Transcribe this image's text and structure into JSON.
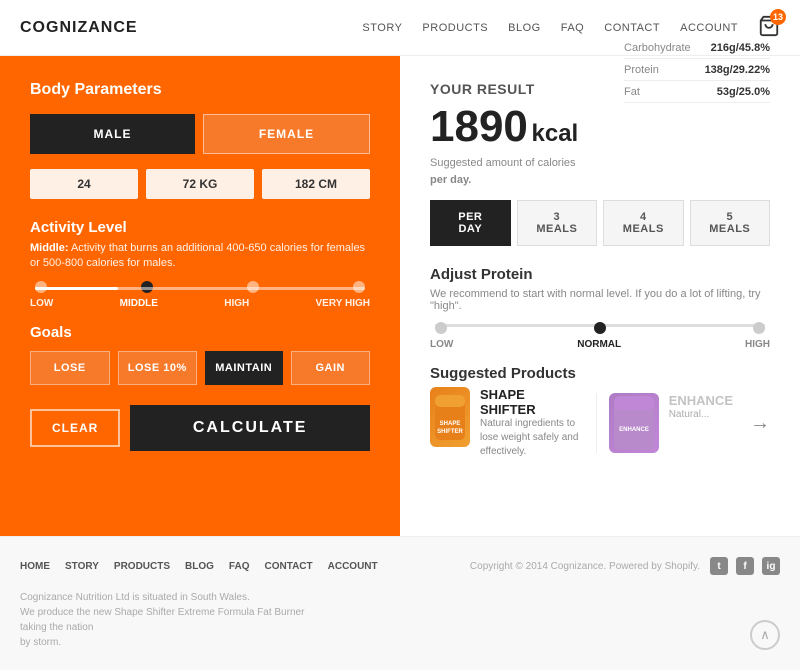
{
  "header": {
    "logo": "COGNIZANCE",
    "nav_items": [
      "STORY",
      "PRODUCTS",
      "BLOG",
      "FAQ",
      "CONTACT",
      "ACCOUNT"
    ],
    "cart_count": "13"
  },
  "left_panel": {
    "body_params_title": "Body Parameters",
    "gender_male": "MALE",
    "gender_female": "FEMALE",
    "age_value": "24",
    "weight_value": "72 KG",
    "height_value": "182 CM",
    "activity_title": "Activity Level",
    "activity_desc_bold": "Middle:",
    "activity_desc": " Activity that burns an additional 400-650 calories for females or 500-800 calories for males.",
    "activity_levels": [
      "LOW",
      "MIDDLE",
      "HIGH",
      "VERY HIGH"
    ],
    "active_level": "MIDDLE",
    "goals_title": "Goals",
    "goals": [
      "LOSE",
      "LOSE 10%",
      "MAINTAIN",
      "GAIN"
    ],
    "active_goal": "MAINTAIN",
    "clear_btn": "CLEAR",
    "calculate_btn": "CALcULATE"
  },
  "right_panel": {
    "result_title": "Your Result",
    "kcal_value": "1890",
    "kcal_unit": "kcal",
    "kcal_desc_line1": "Suggested amount of calories",
    "kcal_desc_line2": "per day.",
    "macros": [
      {
        "name": "Carbohydrate",
        "value": "216g/45.8%"
      },
      {
        "name": "Protein",
        "value": "138g/29.22%"
      },
      {
        "name": "Fat",
        "value": "53g/25.0%"
      }
    ],
    "meal_tabs": [
      "PER DAY",
      "3 MEALS",
      "4 MEALS",
      "5 MEALS"
    ],
    "active_meal_tab": "PER DAY",
    "adjust_title": "Adjust Protein",
    "adjust_desc": "We recommend to start with normal level. If you do a lot of lifting, try \"high\".",
    "protein_levels": [
      "LOW",
      "NORMAL",
      "HIGH"
    ],
    "active_protein": "NORMAL",
    "products_title": "Suggested Products",
    "product1_name": "SHAPE SHIFTER",
    "product1_desc": "Natural ingredients to lose weight safely and effectively.",
    "product2_name": "ENHANCE",
    "product2_desc": "Natural..."
  },
  "footer": {
    "nav_items": [
      "HOME",
      "STORY",
      "PRODUCTS",
      "BLOG",
      "FAQ",
      "CONTACT",
      "ACCOUNT"
    ],
    "copyright": "Copyright © 2014 Cognizance. Powered by Shopify.",
    "company_desc_line1": "Cognizance Nutrition Ltd is situated in South Wales.",
    "company_desc_line2": "We produce the new Shape Shifter Extreme Formula Fat Burner taking the nation",
    "company_desc_line3": "by storm."
  }
}
